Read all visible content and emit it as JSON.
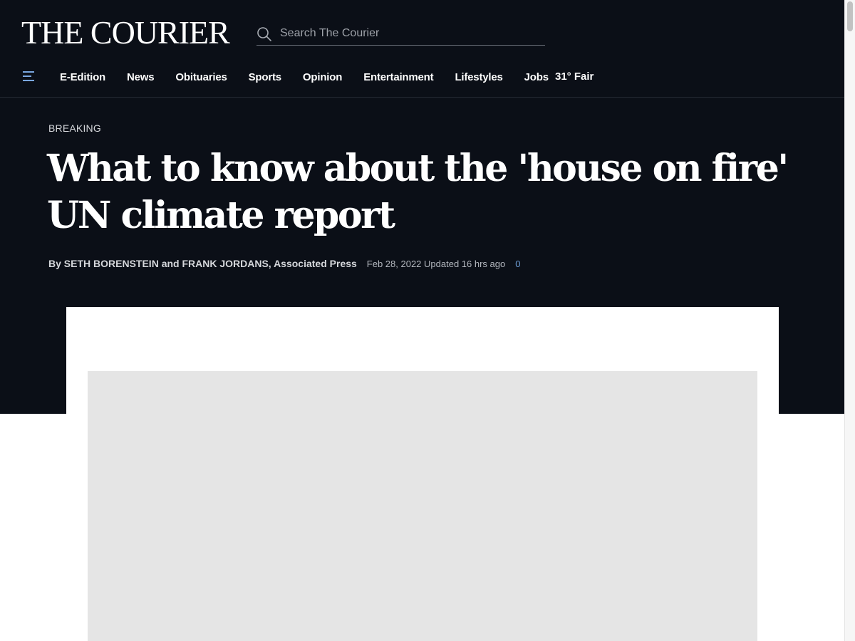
{
  "site": {
    "logo": "THE COURIER"
  },
  "search": {
    "placeholder": "Search The Courier"
  },
  "nav": {
    "items": [
      {
        "label": "E-Edition"
      },
      {
        "label": "News"
      },
      {
        "label": "Obituaries"
      },
      {
        "label": "Sports"
      },
      {
        "label": "Opinion"
      },
      {
        "label": "Entertainment"
      },
      {
        "label": "Lifestyles"
      },
      {
        "label": "Jobs"
      }
    ],
    "weather": "31° Fair"
  },
  "article": {
    "kicker": "BREAKING",
    "headline": "What to know about the 'house on fire' UN climate report",
    "byline": "By SETH BORENSTEIN and FRANK JORDANS, Associated Press",
    "date": "Feb 28, 2022 Updated 16 hrs ago",
    "comment_count": "0"
  },
  "colors": {
    "background_dark": "#0b0f17",
    "text": "#ffffff",
    "muted": "#b3b7be",
    "link": "#6f9fd8",
    "placeholder_box": "#e5e5e5"
  },
  "icons": {
    "menu": "hamburger-menu-icon",
    "search": "search-icon"
  }
}
